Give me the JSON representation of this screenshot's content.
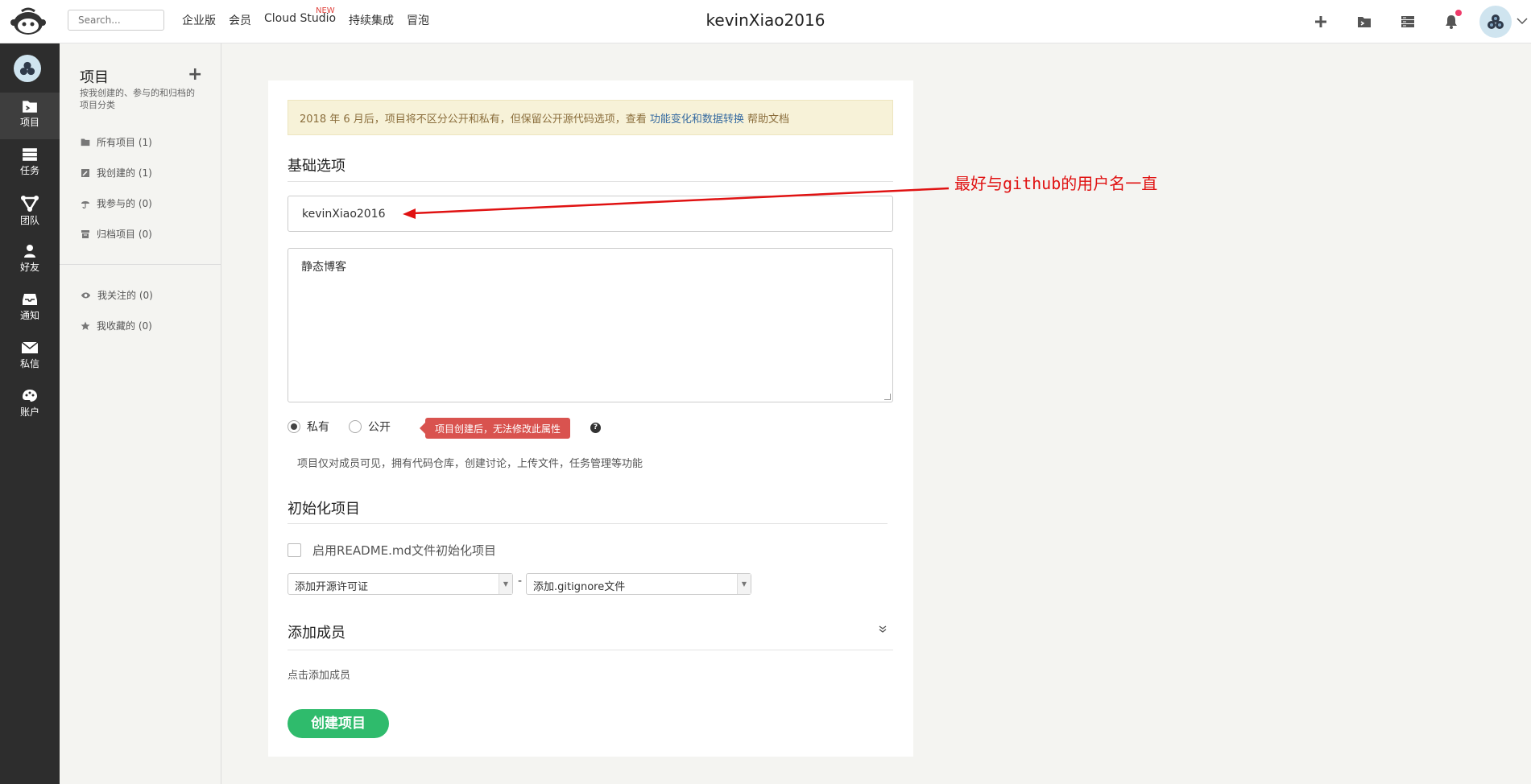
{
  "header": {
    "search_placeholder": "Search...",
    "nav": [
      "企业版",
      "会员",
      "Cloud Studio",
      "持续集成",
      "冒泡"
    ],
    "new_badge": "NEW",
    "page_user": "kevinXiao2016",
    "icons": [
      "plus-icon",
      "project-icon",
      "task-icon",
      "bell-icon"
    ]
  },
  "dark_sidebar": {
    "items": [
      {
        "label": "项目",
        "icon": "project-icon"
      },
      {
        "label": "任务",
        "icon": "task-icon"
      },
      {
        "label": "团队",
        "icon": "team-icon"
      },
      {
        "label": "好友",
        "icon": "friend-icon"
      },
      {
        "label": "通知",
        "icon": "inbox-icon"
      },
      {
        "label": "私信",
        "icon": "mail-icon"
      },
      {
        "label": "账户",
        "icon": "palette-icon"
      }
    ]
  },
  "sub_sidebar": {
    "title": "项目",
    "description": "按我创建的、参与的和归档的项目分类",
    "items": [
      "所有项目 (1)",
      "我创建的 (1)",
      "我参与的 (0)",
      "归档项目 (0)"
    ],
    "items2": [
      "我关注的 (0)",
      "我收藏的 (0)"
    ]
  },
  "form": {
    "notice_prefix": "2018 年 6 月后，项目将不区分公开和私有，但保留公开源代码选项，查看 ",
    "notice_link": "功能变化和数据转换",
    "notice_suffix": " 帮助文档",
    "basic_title": "基础选项",
    "name_value": "kevinXiao2016",
    "description_value": "静态博客",
    "radio_private": "私有",
    "radio_public": "公开",
    "warn_tag": "项目创建后，无法修改此属性",
    "help_mark": "?",
    "privacy_hint": "项目仅对成员可见，拥有代码仓库，创建讨论，上传文件，任务管理等功能",
    "init_title": "初始化项目",
    "readme_label": "启用README.md文件初始化项目",
    "license_select": "添加开源许可证",
    "separator": "-",
    "gitignore_select": "添加.gitignore文件",
    "members_title": "添加成员",
    "members_hint": "点击添加成员",
    "create_button": "创建项目"
  },
  "annotation": {
    "text": "最好与github的用户名一直",
    "color": "#e01212"
  },
  "colors": {
    "accent_green": "#2fbb6c",
    "warn_red": "#d9534f",
    "notice_bg": "#f7f2d8",
    "dark_sidebar": "#2d2d2d"
  }
}
